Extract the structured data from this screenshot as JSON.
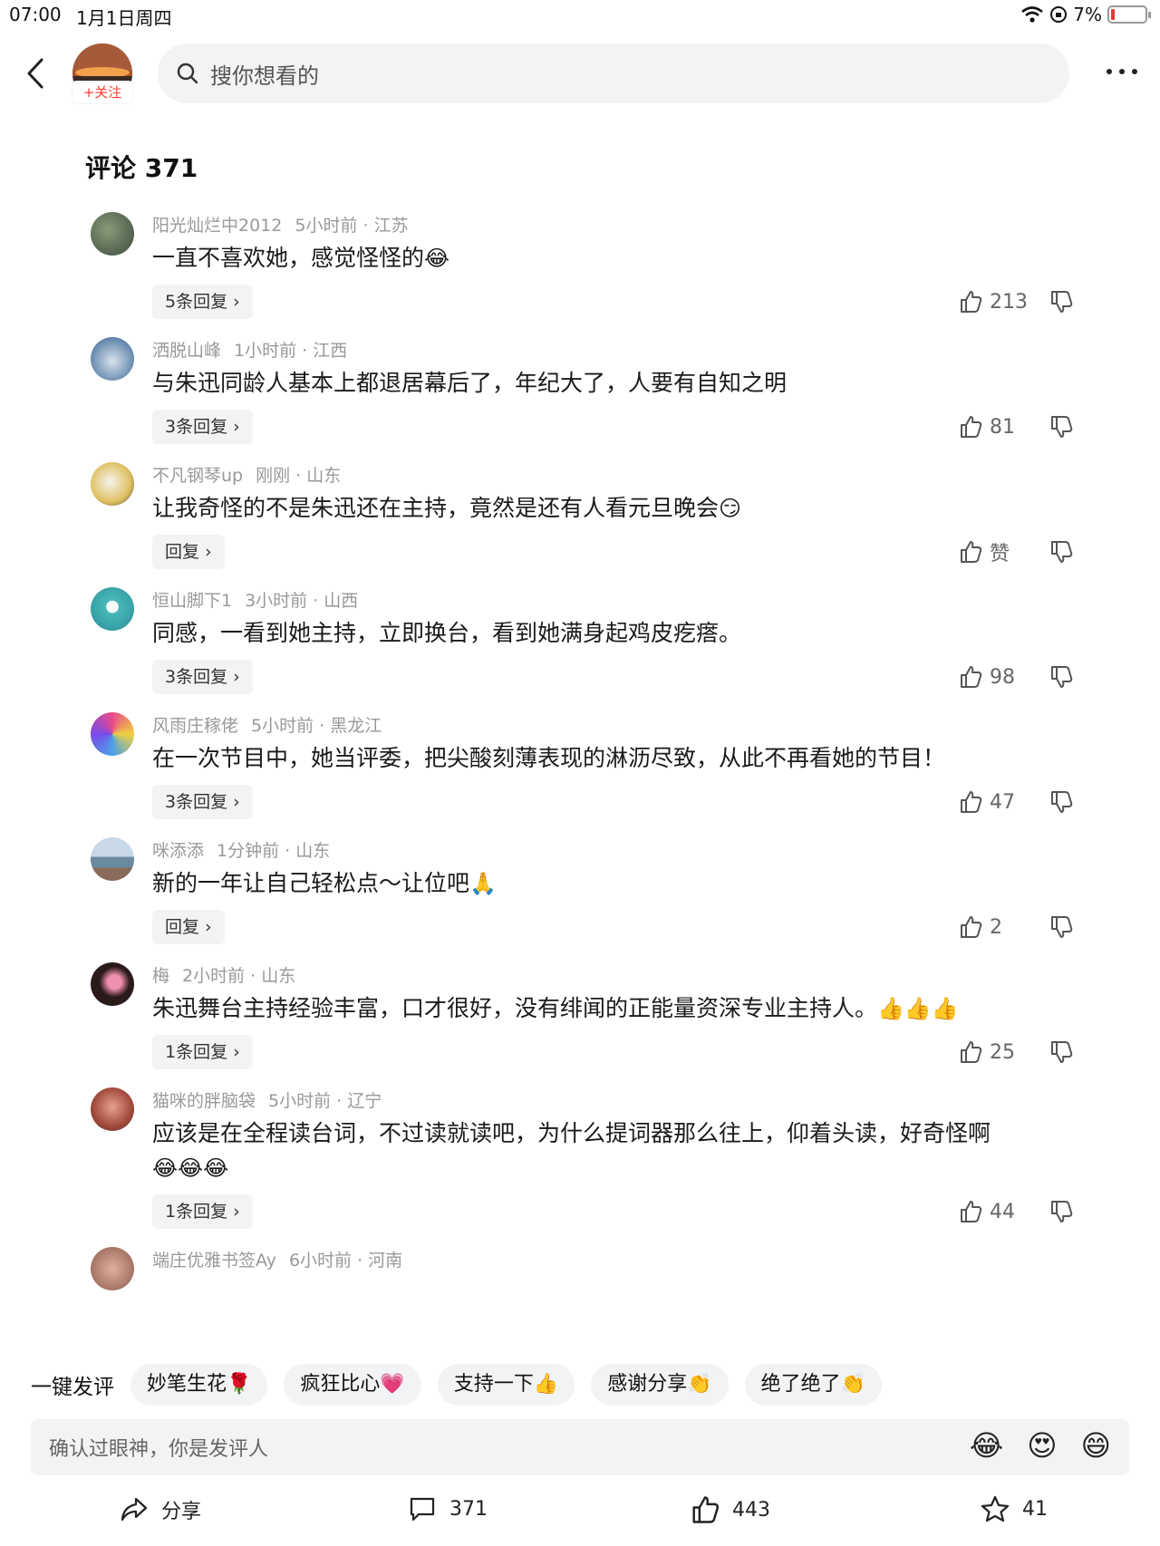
{
  "status_bar": {
    "time": "07:00",
    "date": "1月1日周四",
    "battery": "7%"
  },
  "header": {
    "follow_label": "+关注",
    "search_placeholder": "搜你想看的"
  },
  "comments_title": "评论 371",
  "comments": [
    {
      "user": "阳光灿烂中2012",
      "time": "5小时前 · 江苏",
      "text": "一直不喜欢她，感觉怪怪的",
      "emoji": "😂",
      "replies": "5条回复 ›",
      "likes": "213"
    },
    {
      "user": "洒脱山峰",
      "time": "1小时前 · 江西",
      "text": "与朱迅同龄人基本上都退居幕后了，年纪大了，人要有自知之明",
      "emoji": "",
      "replies": "3条回复 ›",
      "likes": "81"
    },
    {
      "user": "不凡钢琴up",
      "time": "刚刚 · 山东",
      "text": "让我奇怪的不是朱迅还在主持，竟然是还有人看元旦晚会",
      "emoji": "😏",
      "replies": "回复 ›",
      "likes": "赞"
    },
    {
      "user": "恒山脚下1",
      "time": "3小时前 · 山西",
      "text": "同感，一看到她主持，立即换台，看到她满身起鸡皮疙瘩。",
      "emoji": "",
      "replies": "3条回复 ›",
      "likes": "98"
    },
    {
      "user": "风雨庄稼佬",
      "time": "5小时前 · 黑龙江",
      "text": "在一次节目中，她当评委，把尖酸刻薄表现的淋沥尽致，从此不再看她的节目！",
      "emoji": "",
      "replies": "3条回复 ›",
      "likes": "47"
    },
    {
      "user": "咪添添",
      "time": "1分钟前 · 山东",
      "text": "新的一年让自己轻松点～让位吧",
      "emoji": "🙏",
      "replies": "回复 ›",
      "likes": "2"
    },
    {
      "user": "梅",
      "time": "2小时前 · 山东",
      "text": "朱迅舞台主持经验丰富，口才很好，没有绯闻的正能量资深专业主持人。",
      "emoji": "👍👍👍",
      "replies": "1条回复 ›",
      "likes": "25"
    },
    {
      "user": "猫咪的胖脑袋",
      "time": "5小时前 · 辽宁",
      "text": "应该是在全程读台词，不过读就读吧，为什么提词器那么往上，仰着头读，好奇怪啊",
      "emoji": "😂😂😂",
      "replies": "1条回复 ›",
      "likes": "44"
    },
    {
      "user": "端庄优雅书签Ay",
      "time": "6小时前 · 河南",
      "text": "",
      "emoji": "",
      "replies": "",
      "likes": ""
    }
  ],
  "quick_comment": {
    "label": "一键发评",
    "chips": [
      "妙笔生花🌹",
      "疯狂比心💗",
      "支持一下👍",
      "感谢分享👏",
      "绝了绝了👏"
    ]
  },
  "input": {
    "placeholder": "确认过眼神，你是发评人",
    "emojis": [
      "😂",
      "😍",
      "😄"
    ]
  },
  "actions": {
    "share_label": "分享",
    "comment_count": "371",
    "like_count": "443",
    "favorite_count": "41"
  }
}
